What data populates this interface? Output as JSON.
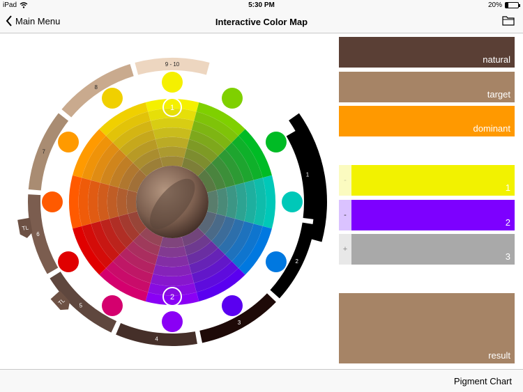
{
  "status": {
    "device": "iPad",
    "time": "5:30 PM",
    "battery": "20%",
    "battery_level": 0.2
  },
  "nav": {
    "back_label": "Main Menu",
    "title": "Interactive Color Map"
  },
  "wheel": {
    "hue_colors": [
      "#f5f000",
      "#7fd000",
      "#00bb25",
      "#00c8b8",
      "#0078e0",
      "#5a00f0",
      "#8a00f5",
      "#d4006e",
      "#e00000",
      "#ff5a00",
      "#ff9a00",
      "#f0d000"
    ],
    "markers": [
      "1",
      "2"
    ],
    "scale_labels": [
      "9 - 10",
      "8",
      "7",
      "6",
      "5",
      "4",
      "3",
      "2",
      "1"
    ],
    "tag_labels": [
      "TL",
      "TL"
    ]
  },
  "swatches": {
    "natural": {
      "label": "natural",
      "color": "#5a3f35"
    },
    "target": {
      "label": "target",
      "color": "#a68466"
    },
    "dominant": {
      "label": "dominant",
      "color": "#ff9900"
    },
    "mix1": {
      "label": "1",
      "color": "#f2f200",
      "tab": "-",
      "tab_color": "#fbfbc0",
      "tab_text_color": "#c9c9a0"
    },
    "mix2": {
      "label": "2",
      "color": "#7d00ff",
      "tab": "-",
      "tab_color": "#dac2ff",
      "tab_text_color": "#333333"
    },
    "mix3": {
      "label": "3",
      "color": "#a9a9a9",
      "tab": "+",
      "tab_color": "#e8e8e8",
      "tab_text_color": "#888888"
    },
    "result": {
      "label": "result",
      "color": "#a68466"
    }
  },
  "bottom": {
    "pigment_chart_label": "Pigment Chart"
  }
}
